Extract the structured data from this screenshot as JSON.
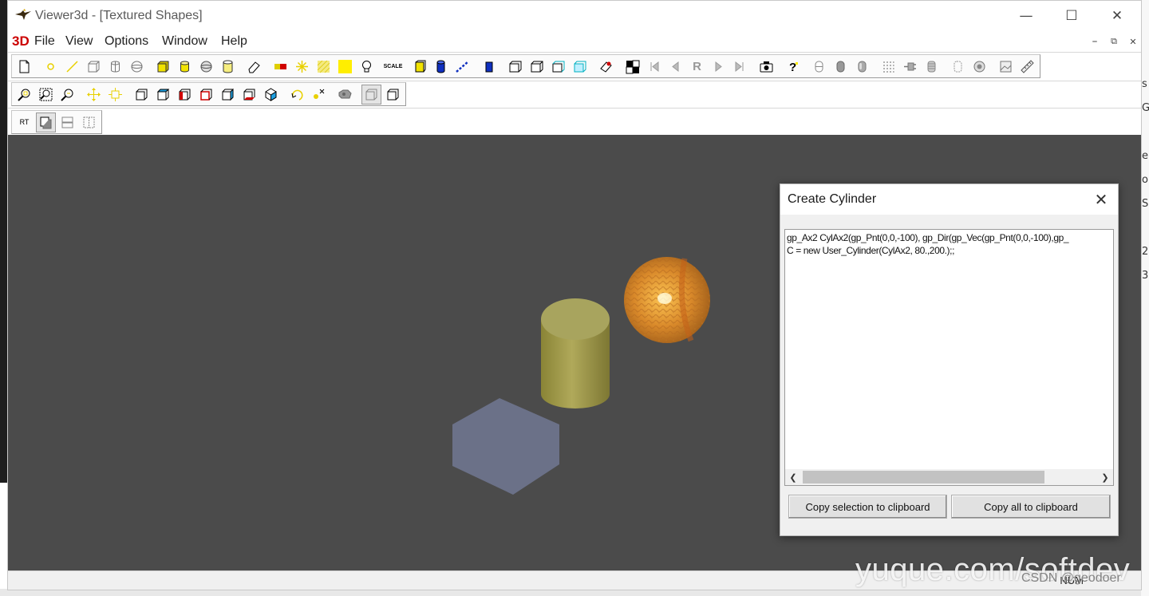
{
  "window": {
    "title": "Viewer3d - [Textured Shapes]",
    "controls": [
      "minimize-icon",
      "maximize-icon",
      "close-icon"
    ]
  },
  "menu": {
    "brand": "3D",
    "items": [
      {
        "label": "File"
      },
      {
        "label": "View"
      },
      {
        "label": "Options"
      },
      {
        "label": "Window"
      },
      {
        "label": "Help"
      }
    ],
    "mdi_controls": [
      "mdi-minimize-icon",
      "mdi-restore-icon",
      "mdi-close-icon"
    ]
  },
  "toolbar": {
    "replay_label": "R",
    "scale_label": "SCALE",
    "rt_label": "RT"
  },
  "viewer": {
    "background": "#4b4b4b",
    "shapes": [
      "hexagon-prism",
      "cylinder",
      "textured-sphere"
    ]
  },
  "dialog": {
    "title": "Create Cylinder",
    "code_lines": [
      "gp_Ax2 CylAx2(gp_Pnt(0,0,-100), gp_Dir(gp_Vec(gp_Pnt(0,0,-100),gp_",
      "C = new User_Cylinder(CylAx2, 80.,200.);;"
    ],
    "buttons": {
      "copy_selection": "Copy selection to clipboard",
      "copy_all": "Copy all to clipboard"
    }
  },
  "status": {
    "num": "NUM"
  },
  "watermark": {
    "text": "yuque.com/softdev",
    "csdn": "CSDN @geodoer"
  },
  "desktop_right_fragments": [
    "s",
    "G",
    "e",
    "o",
    "S",
    "2",
    "3"
  ]
}
